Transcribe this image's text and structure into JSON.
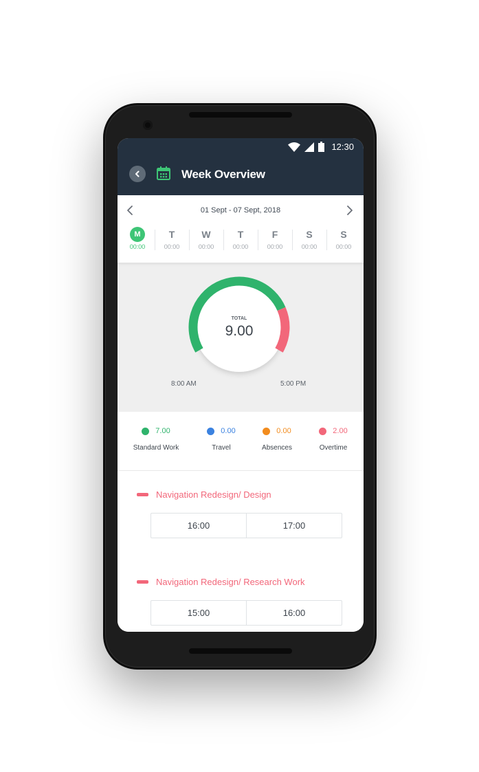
{
  "status_bar": {
    "time": "12:30"
  },
  "header": {
    "title": "Week Overview"
  },
  "week": {
    "range": "01 Sept - 07 Sept, 2018",
    "days": [
      {
        "letter": "M",
        "time": "00:00",
        "active": true
      },
      {
        "letter": "T",
        "time": "00:00",
        "active": false
      },
      {
        "letter": "W",
        "time": "00:00",
        "active": false
      },
      {
        "letter": "T",
        "time": "00:00",
        "active": false
      },
      {
        "letter": "F",
        "time": "00:00",
        "active": false
      },
      {
        "letter": "S",
        "time": "00:00",
        "active": false
      },
      {
        "letter": "S",
        "time": "00:00",
        "active": false
      }
    ]
  },
  "gauge": {
    "label": "TOTAL",
    "value": "9.00",
    "start": "8:00 AM",
    "end": "5:00 PM",
    "standard_hours": 7.0,
    "overtime_hours": 2.0,
    "colors": {
      "standard": "#2fb36c",
      "overtime": "#f2677a"
    }
  },
  "legend": [
    {
      "value": "7.00",
      "name": "Standard Work",
      "color": "#2fb36c"
    },
    {
      "value": "0.00",
      "name": "Travel",
      "color": "#3b82e0"
    },
    {
      "value": "0.00",
      "name": "Absences",
      "color": "#f28c1e"
    },
    {
      "value": "2.00",
      "name": "Overtime",
      "color": "#f2677a"
    }
  ],
  "projects": [
    {
      "name": "Navigation Redesign/ Design",
      "start": "16:00",
      "end": "17:00"
    },
    {
      "name": "Navigation Redesign/ Research Work",
      "start": "15:00",
      "end": "16:00"
    }
  ],
  "icons": {
    "back": "chevron-left-icon",
    "calendar": "calendar-icon",
    "prev": "chevron-left-icon",
    "next": "chevron-right-icon"
  }
}
